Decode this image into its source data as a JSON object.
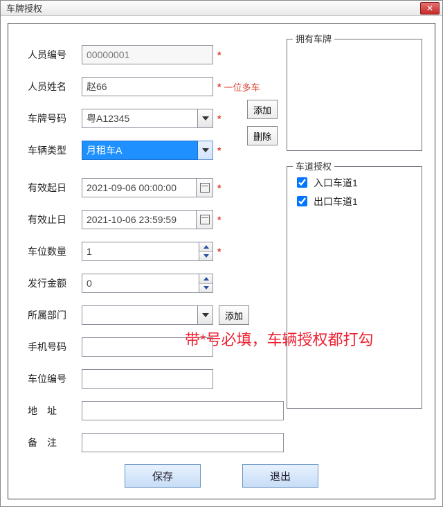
{
  "window": {
    "title": "车牌授权"
  },
  "labels": {
    "person_no": "人员编号",
    "person_name": "人员姓名",
    "plate_no": "车牌号码",
    "vehicle_type": "车辆类型",
    "valid_from": "有效起日",
    "valid_to": "有效止日",
    "slot_count": "车位数量",
    "issue_amount": "发行金额",
    "dept": "所属部门",
    "phone": "手机号码",
    "slot_no": "车位编号",
    "address": "地　址",
    "remark": "备　注"
  },
  "values": {
    "person_no": "00000001",
    "person_name": "赵66",
    "plate_no": "粤A12345",
    "vehicle_type": "月租车A",
    "valid_from": "2021-09-06 00:00:00",
    "valid_to": "2021-10-06 23:59:59",
    "slot_count": "1",
    "issue_amount": "0",
    "dept": "",
    "phone": "",
    "slot_no": "",
    "address": "",
    "remark": ""
  },
  "notes": {
    "multi_car": "一位多车"
  },
  "buttons": {
    "add": "添加",
    "del": "删除",
    "add_dept": "添加",
    "save": "保存",
    "exit": "退出"
  },
  "groups": {
    "owned": "拥有车牌",
    "lanes": "车道授权"
  },
  "lanes": [
    {
      "label": "入口车道1",
      "checked": true
    },
    {
      "label": "出口车道1",
      "checked": true
    }
  ],
  "hint": "带*号必填，车辆授权都打勾"
}
